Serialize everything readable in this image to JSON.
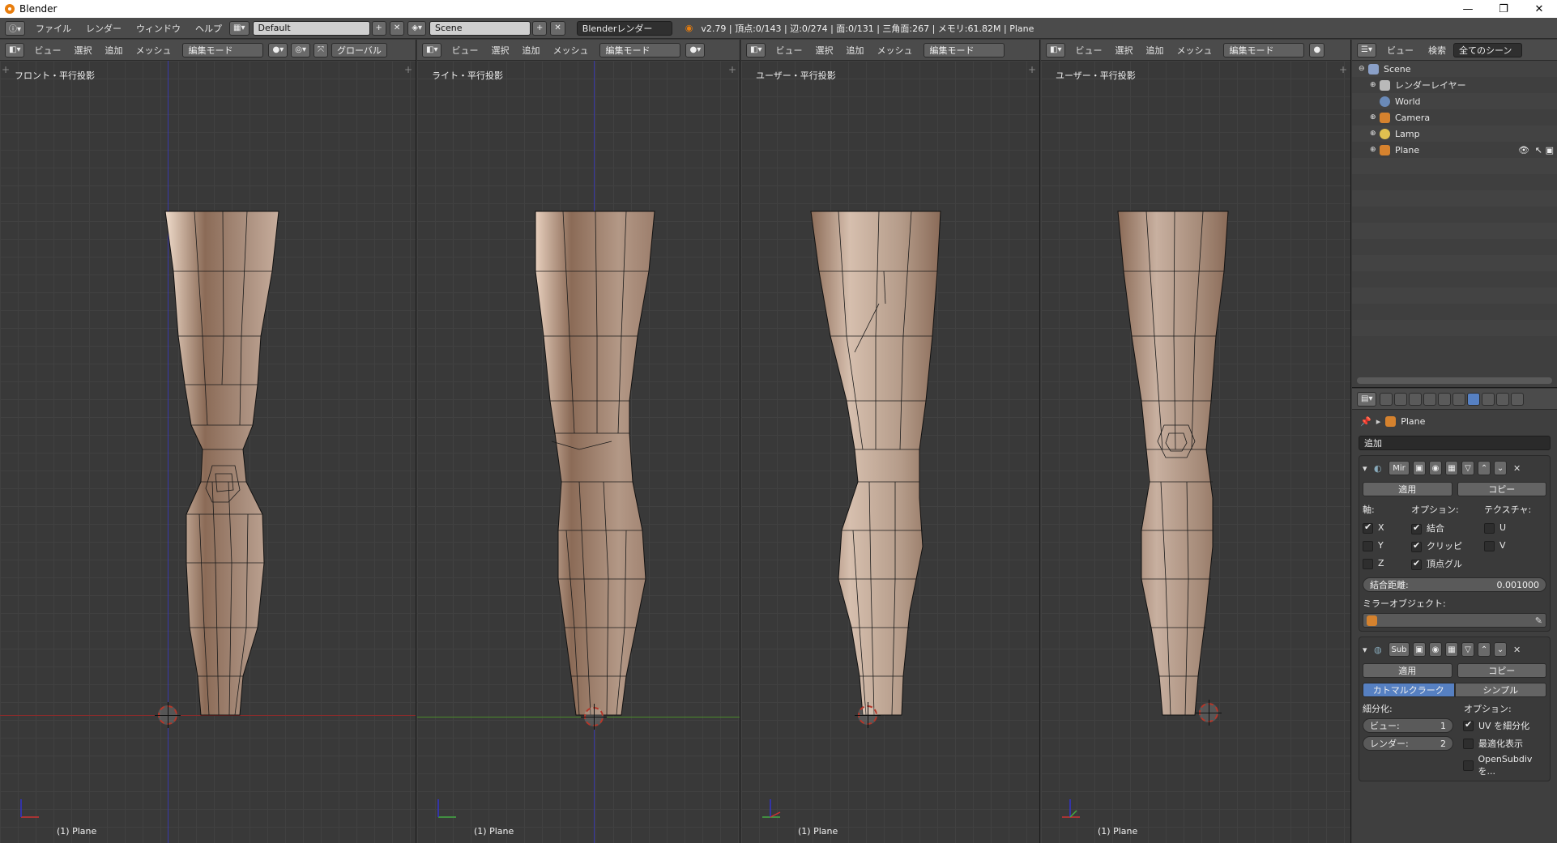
{
  "window": {
    "title": "Blender",
    "minimize": "—",
    "restore": "❐",
    "close": "✕"
  },
  "info_header": {
    "menus": [
      "ファイル",
      "レンダー",
      "ウィンドウ",
      "ヘルプ"
    ],
    "layout": "Default",
    "scene": "Scene",
    "engine": "Blenderレンダー",
    "stats": "v2.79 | 頂点:0/143 | 辺:0/274 | 面:0/131 | 三角面:267 | メモリ:61.82M | Plane"
  },
  "viewport_menus": [
    "ビュー",
    "選択",
    "追加",
    "メッシュ"
  ],
  "edit_mode": "編集モード",
  "orientation": "グローバル",
  "viewports": [
    {
      "label": "フロント・平行投影",
      "object": "(1) Plane"
    },
    {
      "label": "ライト・平行投影",
      "object": "(1) Plane"
    },
    {
      "label": "ユーザー・平行投影",
      "object": "(1) Plane"
    },
    {
      "label": "ユーザー・平行投影",
      "object": "(1) Plane"
    }
  ],
  "outliner": {
    "menus": [
      "ビュー",
      "検索"
    ],
    "filter": "全てのシーン",
    "items": [
      {
        "name": "Scene",
        "icon": "scene-icon"
      },
      {
        "name": "レンダーレイヤー",
        "icon": "render-layer-icon"
      },
      {
        "name": "World",
        "icon": "world-icon"
      },
      {
        "name": "Camera",
        "icon": "camera-icon"
      },
      {
        "name": "Lamp",
        "icon": "lamp-icon"
      },
      {
        "name": "Plane",
        "icon": "mesh-icon"
      }
    ]
  },
  "properties": {
    "breadcrumb": "Plane",
    "add_modifier": "追加",
    "mirror": {
      "name": "Mir",
      "apply": "適用",
      "copy": "コピー",
      "axis_label": "軸:",
      "options_label": "オプション:",
      "texture_label": "テクスチャ:",
      "axes": [
        {
          "label": "X",
          "checked": true
        },
        {
          "label": "Y",
          "checked": false
        },
        {
          "label": "Z",
          "checked": false
        }
      ],
      "options": [
        {
          "label": "結合",
          "checked": true
        },
        {
          "label": "クリッピ",
          "checked": true
        },
        {
          "label": "頂点グル",
          "checked": true
        }
      ],
      "textures": [
        {
          "label": "U",
          "checked": false
        },
        {
          "label": "V",
          "checked": false
        }
      ],
      "merge_label": "結合距離:",
      "merge_value": "0.001000",
      "mirror_object_label": "ミラーオブジェクト:"
    },
    "subsurf": {
      "name": "Sub",
      "apply": "適用",
      "copy": "コピー",
      "catmull": "カトマルクラーク",
      "simple": "シンプル",
      "subdiv_label": "細分化:",
      "options_label": "オプション:",
      "view_label": "ビュー:",
      "view_value": "1",
      "render_label": "レンダー:",
      "render_value": "2",
      "uv": {
        "label": "UV を細分化",
        "checked": true
      },
      "optimal": {
        "label": "最適化表示",
        "checked": false
      },
      "opensubdiv": {
        "label": "OpenSubdivを...",
        "checked": false
      }
    }
  },
  "colors": {
    "x_axis": "#8b2b2b",
    "y_axis": "#4a8a2a",
    "z_axis": "#3a3aaa",
    "accent": "#5680c2",
    "skin": "#a88e7d"
  }
}
